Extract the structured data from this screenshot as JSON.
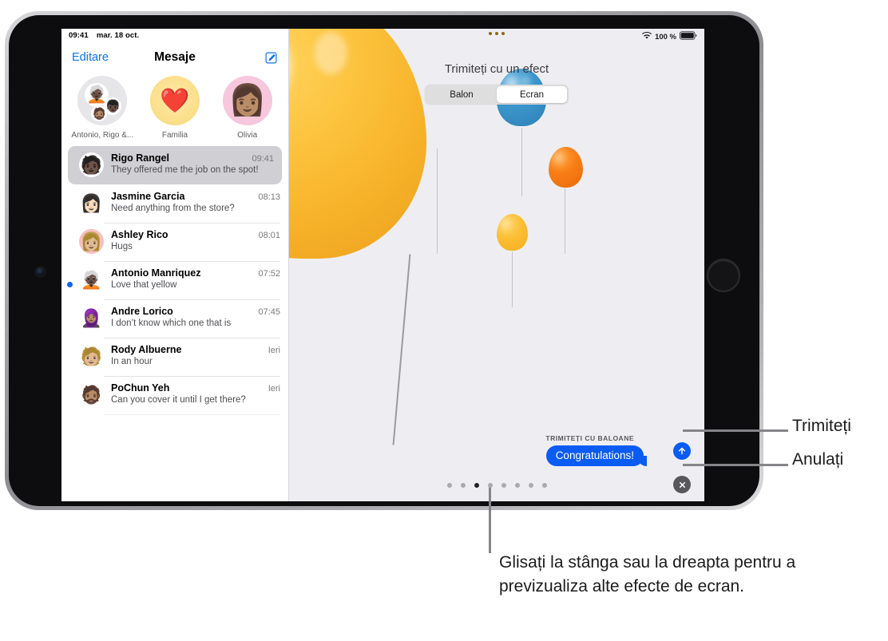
{
  "device": {
    "name": "ipad",
    "home_button": "home-button",
    "camera": "front-camera"
  },
  "status_bar_left": {
    "time": "09:41",
    "date": "mar. 18 oct."
  },
  "status_bar_right": {
    "wifi_icon": "wifi-icon",
    "battery_percent": "100 %",
    "battery_icon": "battery-icon"
  },
  "nav": {
    "edit_label": "Editare",
    "title": "Mesaje",
    "compose_icon": "compose-icon"
  },
  "pinned": [
    {
      "label": "Antonio, Rigo &...",
      "avatar": "group-avatar"
    },
    {
      "label": "Familia",
      "avatar": "heart-avatar",
      "glyph": "❤️"
    },
    {
      "label": "Olivia",
      "avatar": "memoji-avatar"
    }
  ],
  "conversations": [
    {
      "name": "Rigo Rangel",
      "time": "09:41",
      "preview": "They offered me the job on the spot!",
      "selected": true,
      "unread": false
    },
    {
      "name": "Jasmine Garcia",
      "time": "08:13",
      "preview": "Need anything from the store?",
      "selected": false,
      "unread": false
    },
    {
      "name": "Ashley Rico",
      "time": "08:01",
      "preview": "Hugs",
      "selected": false,
      "unread": false
    },
    {
      "name": "Antonio Manriquez",
      "time": "07:52",
      "preview": "Love that yellow",
      "selected": false,
      "unread": true
    },
    {
      "name": "Andre Lorico",
      "time": "07:45",
      "preview": "I don’t know which one that is",
      "selected": false,
      "unread": false
    },
    {
      "name": "Rody Albuerne",
      "time": "Ieri",
      "preview": "In an hour",
      "selected": false,
      "unread": false
    },
    {
      "name": "PoChun Yeh",
      "time": "Ieri",
      "preview": "Can you cover it until I get there?",
      "selected": false,
      "unread": false
    }
  ],
  "effect_panel": {
    "grabber_icon": "grabber-dots-icon",
    "title": "Trimiteți cu un efect",
    "segments": [
      {
        "label": "Balon",
        "selected": false
      },
      {
        "label": "Ecran",
        "selected": true
      }
    ],
    "send_with_label": "TRIMITEȚI CU BALOANE",
    "bubble_text": "Congratulations!",
    "send_icon": "arrow-up-icon",
    "cancel_icon": "close-x-icon",
    "page_dots_total": 8,
    "page_dots_active_index": 2
  },
  "callouts": {
    "send": "Trimiteți",
    "cancel": "Anulați",
    "swipe": "Glisați la stânga sau la dreapta pentru a previzualiza alte efecte de ecran."
  },
  "colors": {
    "accent_blue": "#0b5cf5",
    "link_blue": "#0a74f0",
    "panel_bg": "#eeeef2",
    "selected_row": "#cfcfd4",
    "cancel_gray": "#58585c"
  }
}
